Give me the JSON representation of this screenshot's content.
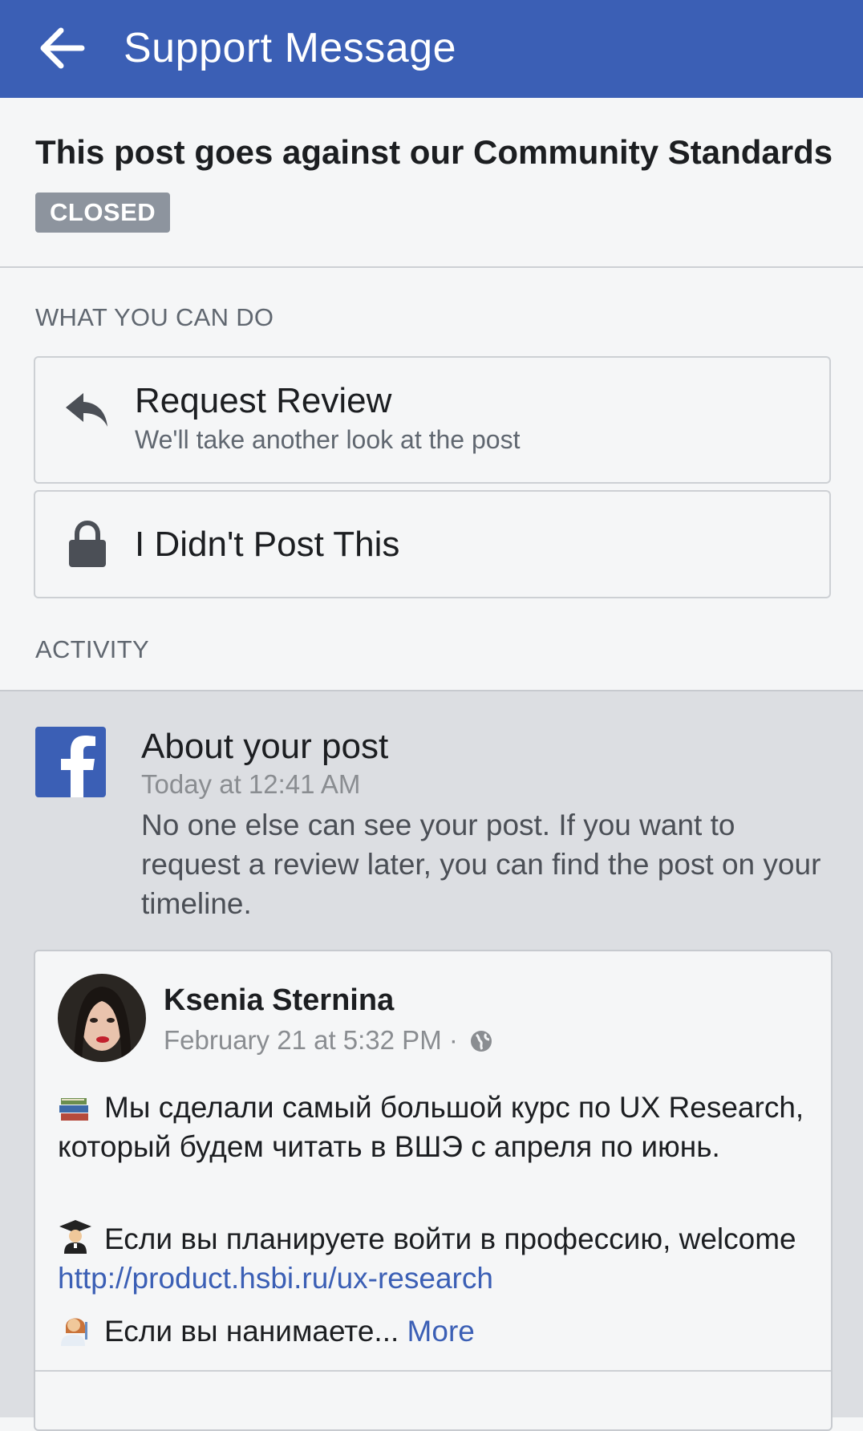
{
  "header": {
    "title": "Support Message"
  },
  "status": {
    "title": "This post goes against our Community Standards",
    "badge": "CLOSED"
  },
  "what_you_can_do": {
    "label": "WHAT YOU CAN DO",
    "options": [
      {
        "title": "Request Review",
        "subtitle": "We'll take another look at the post"
      },
      {
        "title": "I Didn't Post This"
      }
    ]
  },
  "activity": {
    "label": "ACTIVITY",
    "message": {
      "title": "About your post",
      "time": "Today at 12:41 AM",
      "body": "No one else can see your post. If you want to request a review later, you can find the post on your timeline."
    },
    "post": {
      "author": "Ksenia Sternina",
      "date": "February 21 at 5:32 PM ·",
      "para1": "Мы сделали самый большой курс по UX Research, который будем читать в ВШЭ с апреля по июнь.",
      "para2_text": "Если вы планируете войти в профессию, welcome ",
      "para2_link": "http://product.hsbi.ru/ux-research",
      "para3_text": "Если вы нанимаете... ",
      "more": "More"
    }
  },
  "colors": {
    "brand": "#3b5fb5",
    "badge": "#8d949e"
  },
  "icons": [
    "back-arrow-icon",
    "reply-arrow-icon",
    "lock-icon",
    "facebook-logo-icon",
    "globe-icon",
    "books-emoji-icon",
    "graduate-emoji-icon",
    "teacher-emoji-icon"
  ]
}
